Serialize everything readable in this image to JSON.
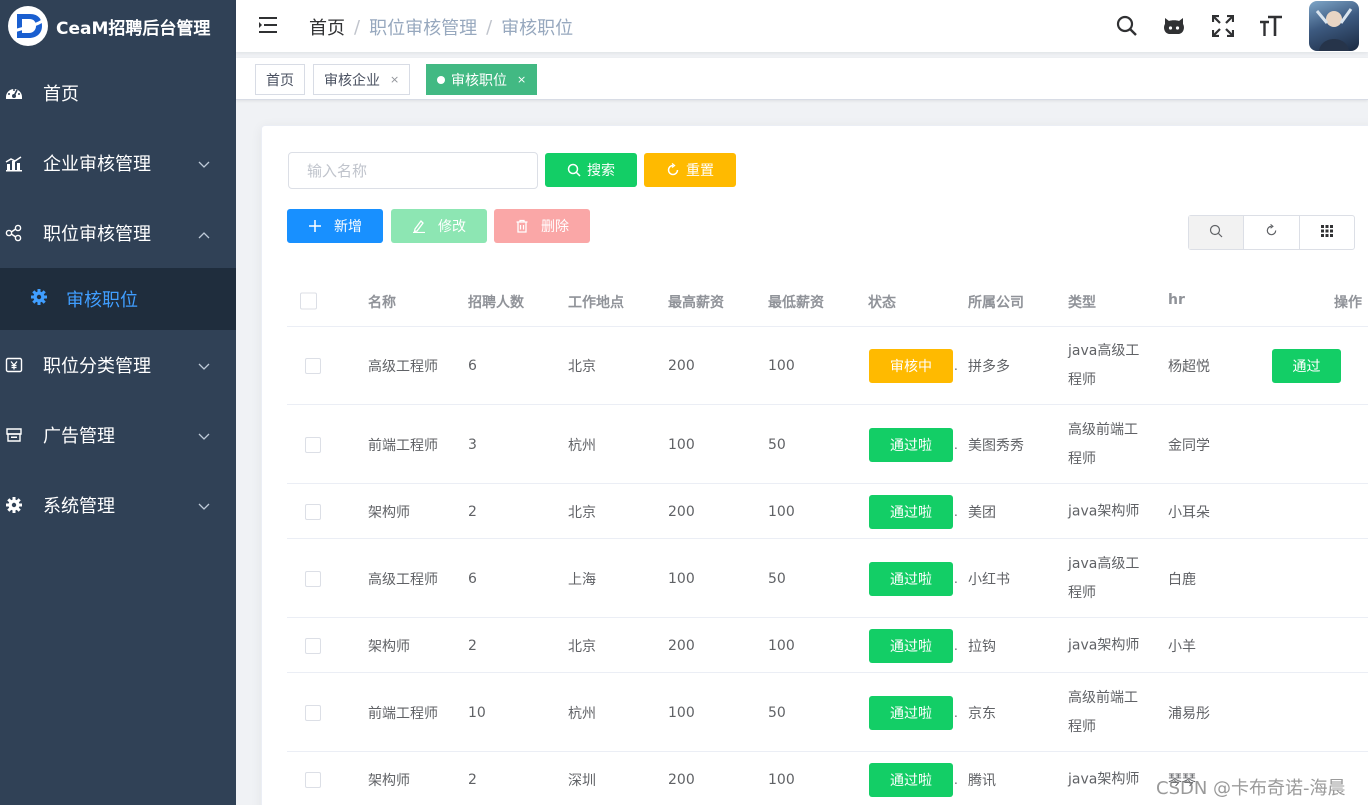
{
  "app": {
    "title": "CeaM招聘后台管理"
  },
  "sidebar": {
    "items": [
      {
        "label": "首页",
        "icon": "dashboard-icon"
      },
      {
        "label": "企业审核管理",
        "icon": "chart-icon"
      },
      {
        "label": "职位审核管理",
        "icon": "share-icon"
      },
      {
        "label": "审核职位",
        "icon": "gear-icon"
      },
      {
        "label": "职位分类管理",
        "icon": "money-icon"
      },
      {
        "label": "广告管理",
        "icon": "shop-icon"
      },
      {
        "label": "系统管理",
        "icon": "cog-icon"
      }
    ]
  },
  "breadcrumb": [
    "首页",
    "职位审核管理",
    "审核职位"
  ],
  "breadcrumb_sep": "/",
  "tags": [
    {
      "label": "首页",
      "close": ""
    },
    {
      "label": "审核企业",
      "close": "×"
    },
    {
      "label": "审核职位",
      "close": "×"
    }
  ],
  "search": {
    "placeholder": "输入名称",
    "search_label": "搜索",
    "reset_label": "重置"
  },
  "toolbar": {
    "add_label": "新增",
    "edit_label": "修改",
    "delete_label": "删除"
  },
  "table": {
    "headers": [
      "名称",
      "招聘人数",
      "工作地点",
      "最高薪资",
      "最低薪资",
      "状态",
      "所属公司",
      "类型",
      "hr",
      "操作"
    ],
    "rows": [
      {
        "name": "高级工程师",
        "count": "6",
        "city": "北京",
        "max": "200",
        "min": "100",
        "status": "审核中",
        "status_dot": ".",
        "company": "拼多多",
        "type": "java高级工程师",
        "hr": "杨超悦",
        "action": "通过"
      },
      {
        "name": "前端工程师",
        "count": "3",
        "city": "杭州",
        "max": "100",
        "min": "50",
        "status": "通过啦",
        "status_dot": ".",
        "company": "美图秀秀",
        "type": "高级前端工程师",
        "hr": "金同学",
        "action": ""
      },
      {
        "name": "架构师",
        "count": "2",
        "city": "北京",
        "max": "200",
        "min": "100",
        "status": "通过啦",
        "status_dot": ".",
        "company": "美团",
        "type": "java架构师",
        "hr": "小耳朵",
        "action": ""
      },
      {
        "name": "高级工程师",
        "count": "6",
        "city": "上海",
        "max": "100",
        "min": "50",
        "status": "通过啦",
        "status_dot": ".",
        "company": "小红书",
        "type": "java高级工程师",
        "hr": "白鹿",
        "action": ""
      },
      {
        "name": "架构师",
        "count": "2",
        "city": "北京",
        "max": "200",
        "min": "100",
        "status": "通过啦",
        "status_dot": ".",
        "company": "拉钩",
        "type": "java架构师",
        "hr": "小羊",
        "action": ""
      },
      {
        "name": "前端工程师",
        "count": "10",
        "city": "杭州",
        "max": "100",
        "min": "50",
        "status": "通过啦",
        "status_dot": ".",
        "company": "京东",
        "type": "高级前端工程师",
        "hr": "浦易彤",
        "action": ""
      },
      {
        "name": "架构师",
        "count": "2",
        "city": "深圳",
        "max": "200",
        "min": "100",
        "status": "通过啦",
        "status_dot": ".",
        "company": "腾讯",
        "type": "java架构师",
        "hr": "琴琴",
        "action": ""
      }
    ]
  },
  "watermark": "CSDN @卡布奇诺-海晨",
  "colors": {
    "sidebar_bg": "#304156",
    "active_tag": "#42b983",
    "success": "#13ce66",
    "warning": "#ffba00",
    "primary": "#1890ff"
  }
}
